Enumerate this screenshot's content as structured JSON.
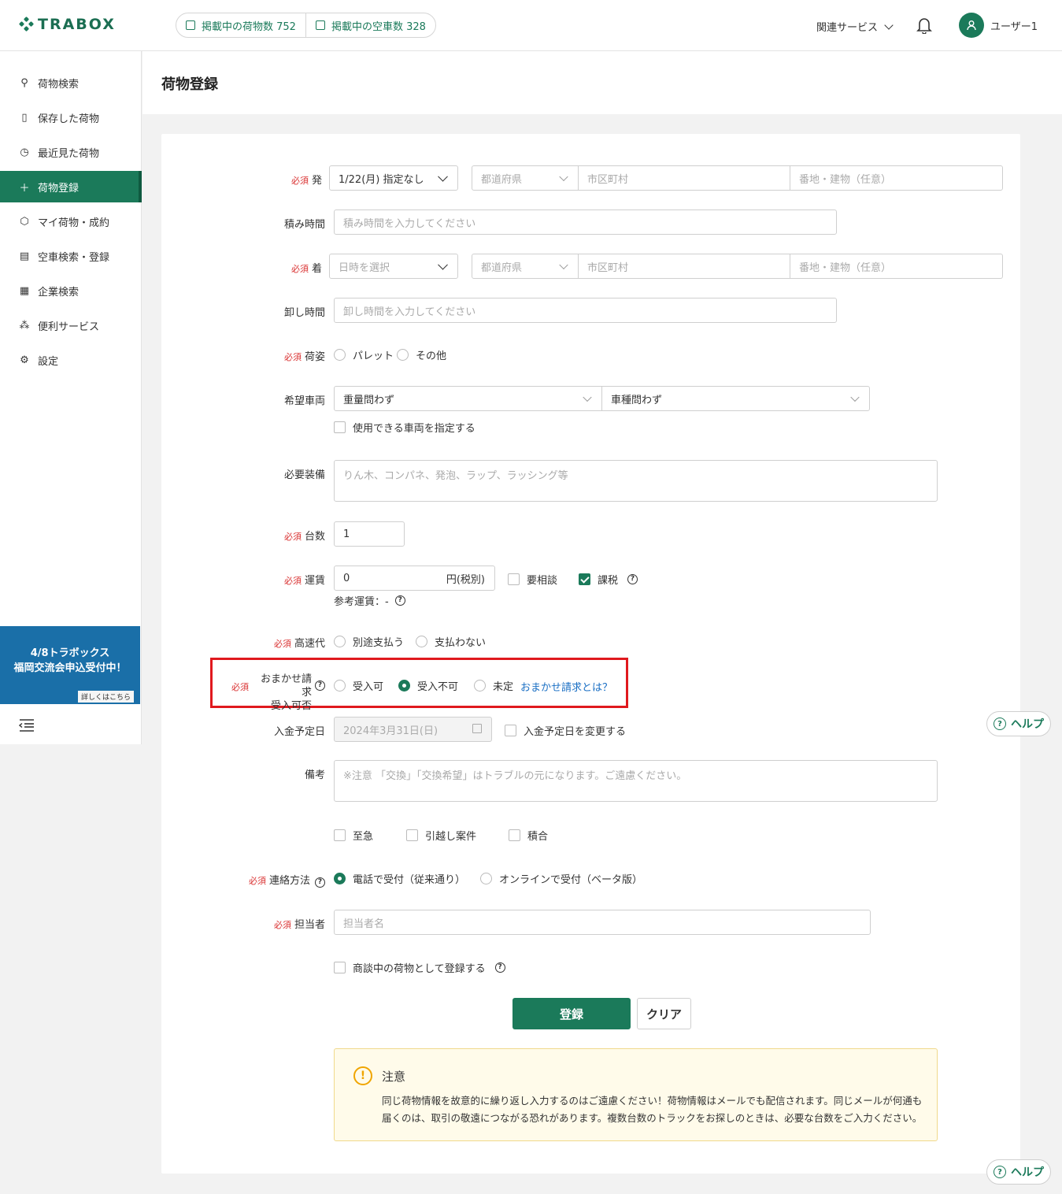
{
  "header": {
    "logo": "TRABOX",
    "stats": [
      {
        "label": "掲載中の荷物数 752"
      },
      {
        "label": "掲載中の空車数 328"
      }
    ],
    "related_services": "関連サービス",
    "user_name": "ユーザー1"
  },
  "sidebar": {
    "items": [
      {
        "label": "荷物検索",
        "icon": "search-icon"
      },
      {
        "label": "保存した荷物",
        "icon": "bookmark-icon"
      },
      {
        "label": "最近見た荷物",
        "icon": "history-icon"
      },
      {
        "label": "荷物登録",
        "icon": "plus-icon",
        "active": true
      },
      {
        "label": "マイ荷物・成約",
        "icon": "box-icon"
      },
      {
        "label": "空車検索・登録",
        "icon": "truck-icon"
      },
      {
        "label": "企業検索",
        "icon": "building-icon"
      },
      {
        "label": "便利サービス",
        "icon": "network-icon"
      },
      {
        "label": "設定",
        "icon": "gear-icon"
      }
    ],
    "banner_line1": "4/8トラボックス",
    "banner_line2": "福岡交流会申込受付中！",
    "banner_link": "詳しくはこちら"
  },
  "page": {
    "title": "荷物登録"
  },
  "form": {
    "required": "必須",
    "departure": {
      "label": "発",
      "date": "1/22(月) 指定なし",
      "pref_placeholder": "都道府県",
      "city_placeholder": "市区町村",
      "address_placeholder": "番地・建物（任意）"
    },
    "loading_time": {
      "label": "積み時間",
      "placeholder": "積み時間を入力してください"
    },
    "arrival": {
      "label": "着",
      "date_placeholder": "日時を選択",
      "pref_placeholder": "都道府県",
      "city_placeholder": "市区町村",
      "address_placeholder": "番地・建物（任意）"
    },
    "unloading_time": {
      "label": "卸し時間",
      "placeholder": "卸し時間を入力してください"
    },
    "packing": {
      "label": "荷姿",
      "options": [
        "パレット",
        "その他"
      ]
    },
    "vehicle": {
      "label": "希望車両",
      "weight": "重量問わず",
      "type": "車種問わず",
      "specify": "使用できる車両を指定する"
    },
    "equipment": {
      "label": "必要装備",
      "placeholder": "りん木、コンパネ、発泡、ラップ、ラッシング等"
    },
    "count": {
      "label": "台数",
      "value": "1"
    },
    "fare": {
      "label": "運賃",
      "value": "0",
      "unit": "円(税別)",
      "negotiable": "要相談",
      "taxable": "課税",
      "reference": "参考運賃：-"
    },
    "highway": {
      "label": "高速代",
      "options": [
        "別途支払う",
        "支払わない"
      ]
    },
    "omakase": {
      "label1": "おまかせ請求",
      "label2": "受入可否",
      "options": [
        "受入可",
        "受入不可",
        "未定"
      ],
      "selected": 1,
      "link": "おまかせ請求とは？"
    },
    "payment_date": {
      "label": "入金予定日",
      "value": "2024年3月31日(日)",
      "change": "入金予定日を変更する"
    },
    "remarks": {
      "label": "備考",
      "placeholder": "※注意 「交換」「交換希望」はトラブルの元になります。ご遠慮ください。"
    },
    "flags": [
      "至急",
      "引越し案件",
      "積合"
    ],
    "contact": {
      "label": "連絡方法",
      "options": [
        "電話で受付（従来通り）",
        "オンラインで受付（ベータ版）"
      ],
      "selected": 0
    },
    "person": {
      "label": "担当者",
      "placeholder": "担当者名"
    },
    "negotiating": "商談中の荷物として登録する",
    "submit": "登録",
    "clear": "クリア"
  },
  "notice": {
    "title": "注意",
    "line1": "同じ荷物情報を故意的に繰り返し入力するのはご遠慮ください！荷物情報はメールでも配信されます。同じメールが何通も",
    "line2": "届くのは、取引の敬遠につながる恐れがあります。複数台数のトラックをお探しのときは、必要な台数をご入力ください。"
  },
  "help": "ヘルプ",
  "colors": {
    "brand": "#1b7a5a",
    "required": "#d93030",
    "highlight": "#e0191e",
    "banner": "#1a6fa8"
  }
}
